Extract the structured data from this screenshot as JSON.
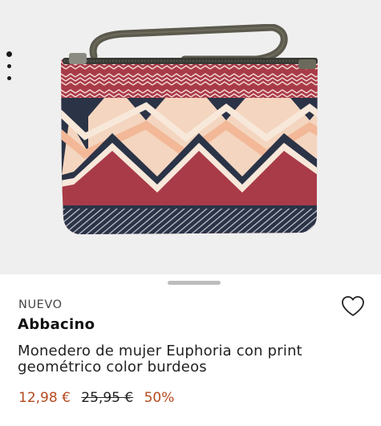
{
  "gallery": {
    "image_count": 3,
    "active_index": 0,
    "colors": {
      "burgundy": "#a93b48",
      "peach": "#f2c0a0",
      "navy": "#2b3347",
      "cream": "#f7e8da",
      "zipper": "#3a3a35",
      "strap": "#5b5a4d"
    }
  },
  "product": {
    "badge": "NUEVO",
    "brand": "Abbacino",
    "title": "Monedero de mujer Euphoria con print geométrico color burdeos",
    "price_current": "12,98 €",
    "price_original": "25,95 €",
    "discount": "50%"
  },
  "icons": {
    "favorite": "heart-outline-icon"
  },
  "colors": {
    "sale": "#b64a1f",
    "text": "#222222",
    "background": "#ffffff"
  }
}
